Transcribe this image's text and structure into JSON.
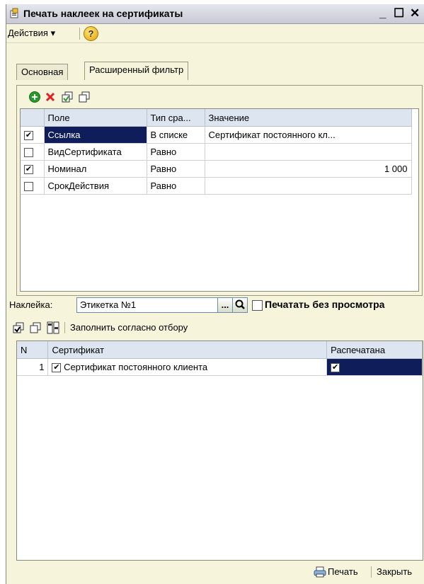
{
  "window": {
    "title": "Печать наклеек на сертификаты",
    "minimize": "_",
    "maximize": "☐",
    "close": "✕"
  },
  "menu": {
    "actions_label": "Действия ▾",
    "help_label": "?"
  },
  "tabs": [
    {
      "label": "Основная",
      "active": false
    },
    {
      "label": "Расширенный фильтр",
      "active": true
    }
  ],
  "filter_toolbar": {
    "add_icon": "add-icon",
    "delete_icon": "delete-icon",
    "copy_icon": "copy-icon",
    "copy2_icon": "copy2-icon"
  },
  "filter_table": {
    "columns": [
      "Поле",
      "Тип сра...",
      "Значение"
    ],
    "rows": [
      {
        "checked": true,
        "field": "Ссылка",
        "type": "В списке",
        "value": "Сертификат постоянного кл..."
      },
      {
        "checked": false,
        "field": "ВидСертификата",
        "type": "Равно",
        "value": ""
      },
      {
        "checked": true,
        "field": "Номинал",
        "type": "Равно",
        "value": "1 000"
      },
      {
        "checked": false,
        "field": "СрокДействия",
        "type": "Равно",
        "value": ""
      }
    ]
  },
  "sticker": {
    "label": "Наклейка:",
    "value": "Этикетка №1",
    "select_button": "...",
    "print_without_preview_label": "Печатать без просмотра"
  },
  "list_toolbar": {
    "fill_label": "Заполнить согласно отбору"
  },
  "cert_table": {
    "columns": [
      "N",
      "Сертификат",
      "Распечатана"
    ],
    "rows": [
      {
        "n": "1",
        "checked": true,
        "certificate": "Сертификат постоянного клиента",
        "printed": true
      }
    ]
  },
  "footer": {
    "print_label": "Печать",
    "close_label": "Закрыть"
  },
  "colors": {
    "panel_bg": "#f6f4da",
    "header_bg": "#dde6f0",
    "selection": "#0f1d5a",
    "delete_red": "#e02020",
    "add_green": "#2a9a2a"
  }
}
